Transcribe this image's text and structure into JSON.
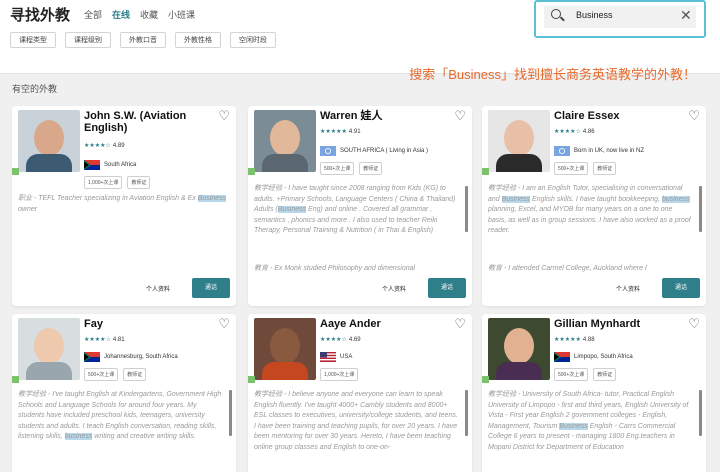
{
  "header": {
    "title": "寻找外教",
    "tabs": [
      "全部",
      "在线",
      "收藏",
      "小班课"
    ],
    "search_value": "Business",
    "filters": [
      "课程类型",
      "课程级别",
      "外教口音",
      "外教性格",
      "空闲时段"
    ]
  },
  "promo": "搜索「Business」找到擅长商务英语教学的外教！",
  "section_title": "有空的外教",
  "actions": {
    "profile": "个人资料",
    "chat": "通话"
  },
  "colors": {
    "accent": "#2a7e8a",
    "promo": "#e66a2c",
    "online": "#7ac36a",
    "highlight": "#b9d8ec"
  },
  "cards": [
    {
      "name": "John S.W. (Aviation English)",
      "stars": "★★★★☆",
      "rating": "4.89",
      "country": "South Africa",
      "badges": [
        "1,000+次上课",
        "教师证"
      ],
      "bio_parts": [
        "职业 - TEFL Teacher specializing in Aviation English & Ex ",
        "Business",
        " owner"
      ]
    },
    {
      "name": "Warren 娃人",
      "stars": "★★★★★",
      "rating": "4.91",
      "country": "SOUTH AFRICA ( Living in Asia )",
      "badges": [
        "500+次上课",
        "教师证"
      ],
      "bio_parts": [
        "教学经验 - I have taught since 2008 ranging from Kids (KG) to adults. +Primary Schools, Language Centers ( China & Thailand) Adults (",
        "Business",
        " Eng) and online . Covered all grammar , semantics , phonics and more . I also used to teacher Reiki Therapy, Personal Training & Nutrition ( in Thai & English)"
      ],
      "bio2": "教育 - Ex Monk studied Philosophy and dimensional"
    },
    {
      "name": "Claire Essex",
      "stars": "★★★★☆",
      "rating": "4.86",
      "country": "Born in UK, now live in NZ",
      "badges": [
        "500+次上课",
        "教师证"
      ],
      "bio_parts": [
        "教学经验 - I am an English Tutor, specialising in conversational and ",
        "Business",
        " English skills. I have taught bookkeeping, ",
        "business",
        " planning, Excel, and MYOB for many years on a one to one basis, as well as in group sessions. I have also worked as a proof reader."
      ],
      "bio2": "教育 - I attended Carmel College, Auckland where I"
    },
    {
      "name": "Fay",
      "stars": "★★★★☆",
      "rating": "4.81",
      "country": "Johannesburg, South Africa",
      "badges": [
        "500+次上课",
        "教师证"
      ],
      "bio_parts": [
        "教学经验 - I've taught English at Kindergartens, Government High Schools and Language Schools for around four years. My students have included preschool kids, teenagers, university students and adults. I teach English conversation, reading skills, listening skills, ",
        "business",
        " writing and creative writing skills."
      ]
    },
    {
      "name": "Aaye Ander",
      "stars": "★★★★☆",
      "rating": "4.69",
      "country": "USA",
      "badges": [
        "1,000+次上课"
      ],
      "bio_parts": [
        "教学经验 - I believe anyone and everyone can learn to speak English fluently. I've taught 4000+ Cambly students and 8000+ ESL classes to executives, university/college students, and teens. I have been training and teaching pupils, for over 20 years. I have been mentoring for over 30 years. Hereto, I have been teaching online group classes and English to one-on-"
      ]
    },
    {
      "name": "Gillian Mynhardt",
      "stars": "★★★★★",
      "rating": "4.88",
      "country": "Limpopo, South Africa",
      "badges": [
        "500+次上课",
        "教师证"
      ],
      "bio_parts": [
        "教学经验 - University of South Africa- tutor, Practical English University of Limpopo - first and third years, English University of Vista - First year English 2 government colleges - English, Management, Tourism ",
        "Business",
        " English - Carrs Commercial College 6 years to present - managing 1800 Eng.teachers in Mopani District for Department of Education"
      ]
    }
  ]
}
